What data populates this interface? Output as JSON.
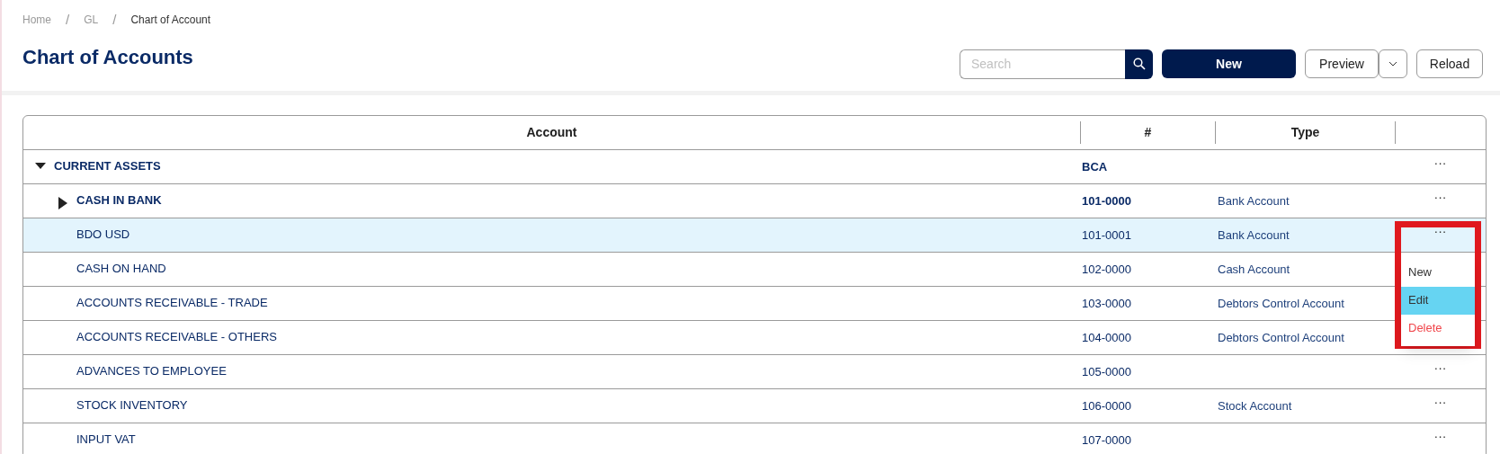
{
  "breadcrumb": [
    {
      "kind": "link",
      "label": "Home"
    },
    {
      "kind": "separator",
      "label": "/"
    },
    {
      "kind": "link",
      "label": "GL"
    },
    {
      "kind": "separator",
      "label": "/"
    },
    {
      "kind": "current",
      "label": "Chart of Account"
    }
  ],
  "title": "Chart of Accounts",
  "toolbar": {
    "search_placeholder": "Search",
    "new_button": "New",
    "preview_button": "Preview",
    "reload_button": "Reload"
  },
  "table": {
    "columns": [
      "Account",
      "#",
      "Type",
      ""
    ],
    "rows": [
      {
        "account": "CURRENT ASSETS",
        "number": "BCA",
        "bold": true,
        "expanded": true,
        "selected": false,
        "actions": "···",
        "children": [
          {
            "account": "CASH IN BANK",
            "number": "101-0000",
            "type": "Bank Account",
            "bold": true,
            "expanded": false,
            "selected": false,
            "actions": "···"
          },
          {
            "account": "BDO USD",
            "number": "101-0001",
            "type": "Bank Account",
            "bold": false,
            "selected": true,
            "actions": "···"
          },
          {
            "account": "CASH ON HAND",
            "number": "102-0000",
            "type": "Cash Account",
            "bold": false,
            "selected": false
          },
          {
            "account": "ACCOUNTS RECEIVABLE - TRADE",
            "number": "103-0000",
            "type": "Debtors Control Account",
            "bold": false,
            "selected": false
          },
          {
            "account": "ACCOUNTS RECEIVABLE - OTHERS",
            "number": "104-0000",
            "type": "Debtors Control Account",
            "bold": false,
            "selected": false
          },
          {
            "account": "ADVANCES TO EMPLOYEE",
            "number": "105-0000",
            "bold": false,
            "selected": false,
            "actions": "···"
          },
          {
            "account": "STOCK INVENTORY",
            "number": "106-0000",
            "type": "Stock Account",
            "bold": false,
            "selected": false,
            "actions": "···"
          },
          {
            "account": "INPUT VAT",
            "number": "107-0000",
            "bold": false,
            "selected": false,
            "actions": "···"
          }
        ]
      }
    ]
  },
  "context_menu": {
    "items": [
      {
        "label": "New",
        "kind": "normal",
        "selected": false
      },
      {
        "label": "Edit",
        "kind": "normal",
        "selected": true
      },
      {
        "label": "Delete",
        "kind": "danger",
        "selected": false
      }
    ]
  }
}
